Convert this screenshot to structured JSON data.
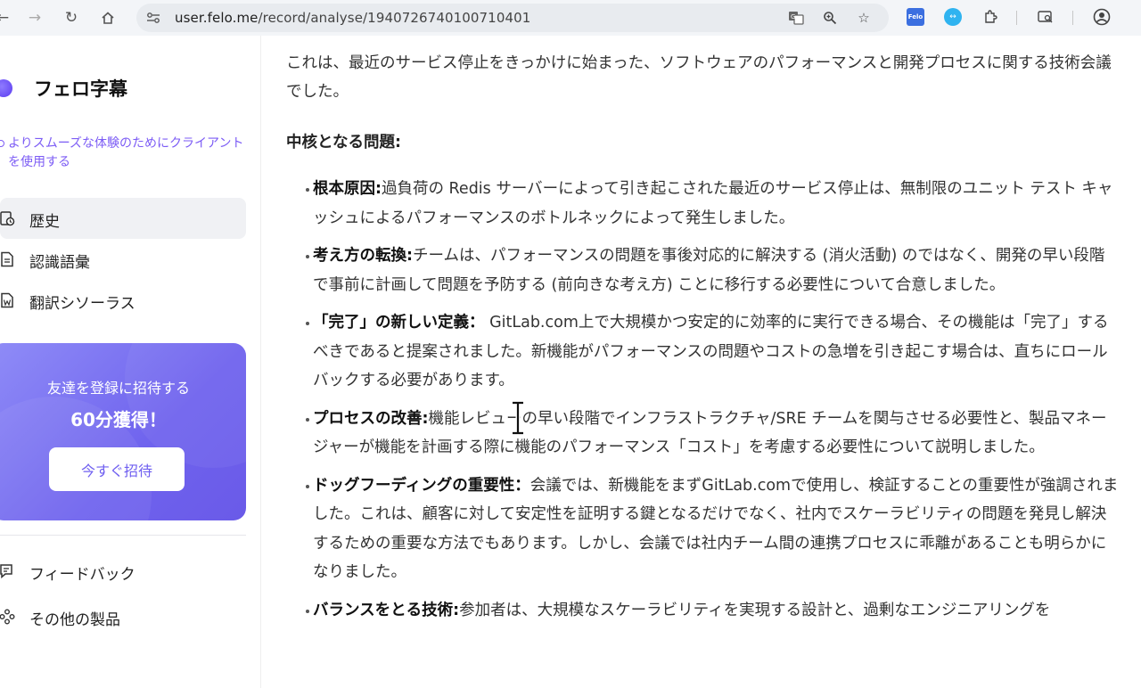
{
  "browser": {
    "url_host": "user.felo.me",
    "url_path": "/record/analyse/1940726740100710401",
    "ext_felo_label": "Felo",
    "ext_round_label": "↔"
  },
  "sidebar": {
    "brand_name": "フェロ字幕",
    "client_promo": "よりスムーズな体験のためにクライアントを使用する",
    "nav": [
      {
        "label": "歴史",
        "icon": "history-icon",
        "active": true
      },
      {
        "label": "認識語彙",
        "icon": "document-icon",
        "active": false
      },
      {
        "label": "翻訳シソーラス",
        "icon": "word-document-icon",
        "active": false
      }
    ],
    "invite": {
      "title": "友達を登録に招待する",
      "reward": "60分獲得！",
      "button_label": "今すぐ招待"
    },
    "footer": [
      {
        "label": "フィードバック",
        "icon": "feedback-icon"
      },
      {
        "label": "その他の製品",
        "icon": "products-icon"
      }
    ]
  },
  "main": {
    "intro": "これは、最近のサービス停止をきっかけに始まった、ソフトウェアのパフォーマンスと開発プロセスに関する技術会議でした。",
    "heading": "中核となる問題:",
    "bullets": [
      {
        "title": "根本原因:",
        "text": "過負荷の Redis サーバーによって引き起こされた最近のサービス停止は、無制限のユニット テスト キャッシュによるパフォーマンスのボトルネックによって発生しました。"
      },
      {
        "title": "考え方の転換:",
        "text": "チームは、パフォーマンスの問題を事後対応的に解決する (消火活動) のではなく、開発の早い段階で事前に計画して問題を予防する (前向きな考え方) ことに移行する必要性について合意しました。"
      },
      {
        "title": "「完了」の新しい定義：",
        "text": " GitLab.com上で大規模かつ安定的に効率的に実行できる場合、その機能は「完了」するべきであると提案されました。新機能がパフォーマンスの問題やコストの急増を引き起こす場合は、直ちにロールバックする必要があります。"
      },
      {
        "title": "プロセスの改善:",
        "text": "機能レビューの早い段階でインフラストラクチャ/SRE チームを関与させる必要性と、製品マネージャーが機能を計画する際に機能のパフォーマンス「コスト」を考慮する必要性について説明しました。"
      },
      {
        "title": "ドッグフーディングの重要性：",
        "text": "会議では、新機能をまずGitLab.comで使用し、検証することの重要性が強調されました。これは、顧客に対して安定性を証明する鍵となるだけでなく、社内でスケーラビリティの問題を発見し解決するための重要な方法でもあります。しかし、会議では社内チーム間の連携プロセスに乖離があることも明らかになりました。"
      },
      {
        "title": "バランスをとる技術:",
        "text": "参加者は、大規模なスケーラビリティを実現する設計と、過剰なエンジニアリングを"
      }
    ]
  }
}
